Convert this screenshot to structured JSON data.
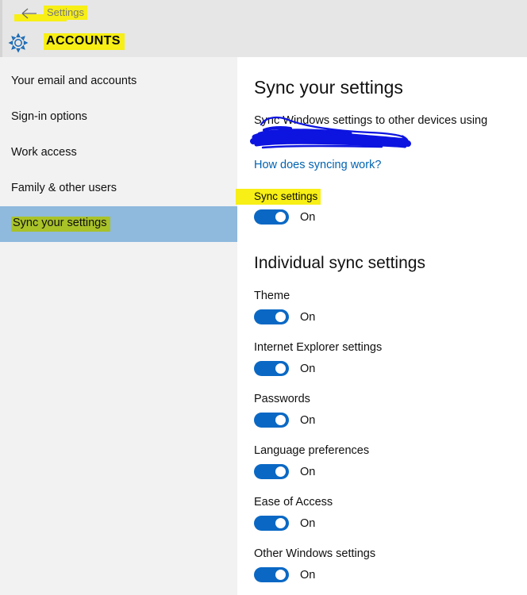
{
  "header": {
    "back_icon": "back-arrow-icon",
    "back_label": "Settings",
    "gear_icon": "gear-icon",
    "app_title": "ACCOUNTS"
  },
  "sidebar": {
    "items": [
      {
        "label": "Your email and accounts",
        "selected": false
      },
      {
        "label": "Sign-in options",
        "selected": false
      },
      {
        "label": "Work access",
        "selected": false
      },
      {
        "label": "Family & other users",
        "selected": false
      },
      {
        "label": "Sync your settings",
        "selected": true
      }
    ]
  },
  "main": {
    "page_title": "Sync your settings",
    "description": "Sync Windows settings to other devices using",
    "link_label": "How does syncing work?",
    "sync_settings": {
      "label": "Sync settings",
      "state": "On"
    },
    "section_title": "Individual sync settings",
    "individual": [
      {
        "label": "Theme",
        "state": "On"
      },
      {
        "label": "Internet Explorer settings",
        "state": "On"
      },
      {
        "label": "Passwords",
        "state": "On"
      },
      {
        "label": "Language preferences",
        "state": "On"
      },
      {
        "label": "Ease of Access",
        "state": "On"
      },
      {
        "label": "Other Windows settings",
        "state": "On"
      }
    ]
  },
  "annotations": {
    "highlight_color": "#f7ef15",
    "scribble_color": "#0d14e0",
    "selection_color": "#8fb9dd",
    "accent_color": "#0a68c4",
    "link_color": "#0063b1"
  }
}
